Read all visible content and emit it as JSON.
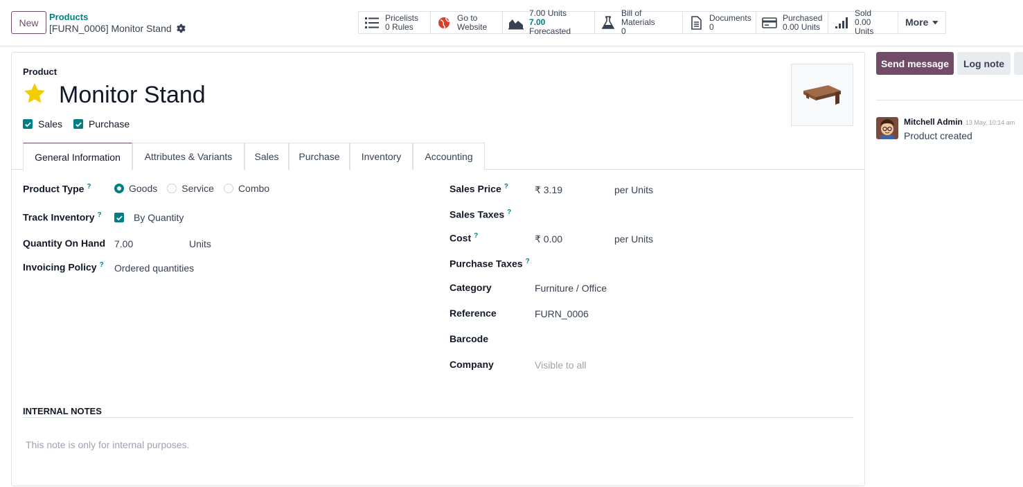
{
  "header": {
    "new_label": "New",
    "breadcrumb_parent": "Products",
    "breadcrumb_current": "[FURN_0006] Monitor Stand"
  },
  "smart_buttons": {
    "pricelists": {
      "line1": "Pricelists",
      "line2": "0 Rules"
    },
    "website": {
      "line1": "Go to",
      "line2": "Website"
    },
    "forecast": {
      "line1": "7.00 Units",
      "line2_value": "7.00",
      "line2_text": "Forecasted"
    },
    "bom": {
      "line1": "Bill of Materials",
      "line2": "0"
    },
    "documents": {
      "line1": "Documents",
      "line2": "0"
    },
    "purchased": {
      "line1": "Purchased",
      "line2": "0.00 Units"
    },
    "sold": {
      "line1": "Sold",
      "line2": "0.00 Units"
    },
    "more": "More"
  },
  "form": {
    "product_label": "Product",
    "name": "Monitor Stand",
    "sales_check": "Sales",
    "purchase_check": "Purchase",
    "tabs": [
      "General Information",
      "Attributes & Variants",
      "Sales",
      "Purchase",
      "Inventory",
      "Accounting"
    ],
    "left": {
      "product_type_label": "Product Type",
      "type_goods": "Goods",
      "type_service": "Service",
      "type_combo": "Combo",
      "track_inventory_label": "Track Inventory",
      "track_by": "By Quantity",
      "qty_label": "Quantity On Hand",
      "qty_value": "7.00",
      "qty_uom": "Units",
      "invoicing_label": "Invoicing Policy",
      "invoicing_value": "Ordered quantities"
    },
    "right": {
      "sales_price_label": "Sales Price",
      "sales_price_value": "₹ 3.19",
      "sales_price_uom": "per Units",
      "sales_taxes_label": "Sales Taxes",
      "cost_label": "Cost",
      "cost_value": "₹ 0.00",
      "cost_uom": "per Units",
      "purchase_taxes_label": "Purchase Taxes",
      "category_label": "Category",
      "category_value": "Furniture / Office",
      "reference_label": "Reference",
      "reference_value": "FURN_0006",
      "barcode_label": "Barcode",
      "company_label": "Company",
      "company_value": "Visible to all"
    },
    "notes_title": "INTERNAL NOTES",
    "notes_placeholder": "This note is only for internal purposes."
  },
  "chatter": {
    "send_label": "Send message",
    "log_label": "Log note",
    "author": "Mitchell Admin",
    "date": "13 May, 10:14 am",
    "message": "Product created"
  },
  "colors": {
    "brand": "#714b67",
    "accent": "#017e84",
    "star": "#f3cc00"
  }
}
